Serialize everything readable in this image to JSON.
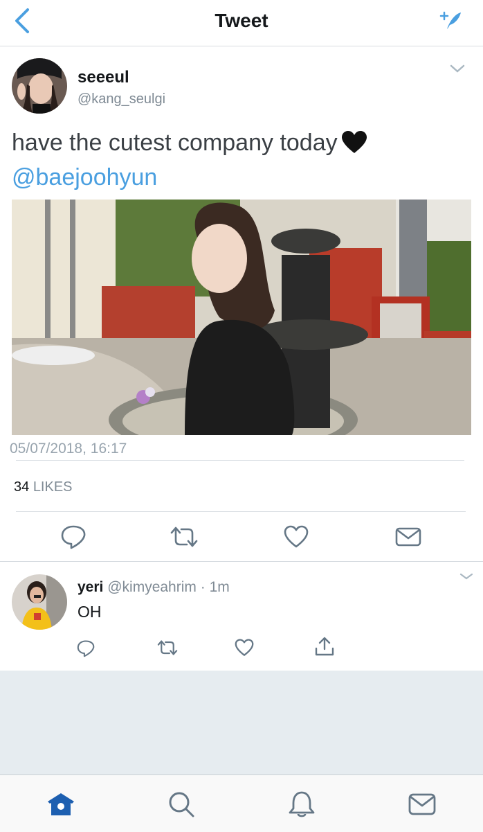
{
  "header": {
    "title": "Tweet",
    "back_icon": "chevron-left-icon",
    "compose_icon": "compose-icon"
  },
  "main_tweet": {
    "display_name": "seeeul",
    "handle": "@kang_seulgi",
    "text": "have the cutest company today",
    "emoji": "black-heart",
    "mention": "@baejoohyun",
    "timestamp": "05/07/2018, 16:17",
    "likes_count": "34",
    "likes_label": "LIKES"
  },
  "reply": {
    "display_name": "yeri",
    "handle": "@kimyeahrim",
    "separator": "·",
    "time": "1m",
    "text": "OH"
  },
  "colors": {
    "link": "#4a9fe0",
    "icon": "#657786",
    "active_tab": "#1d5fb0",
    "gray_bg": "#e6ecf0"
  },
  "tabs": [
    "home-icon",
    "search-icon",
    "notifications-icon",
    "messages-icon"
  ]
}
